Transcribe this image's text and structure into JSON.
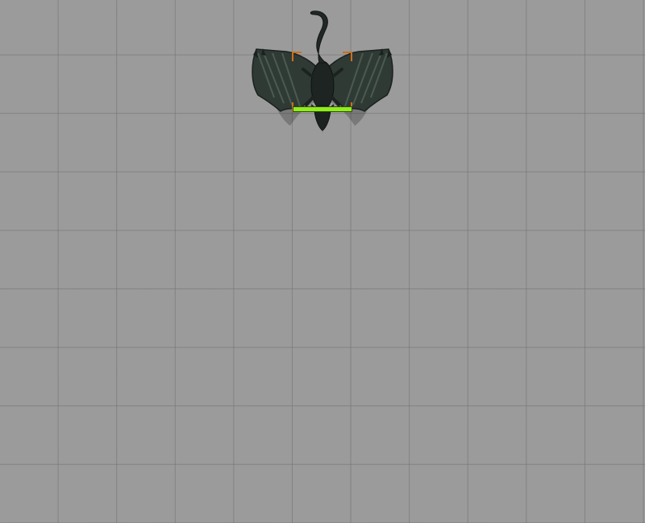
{
  "scene": {
    "grid_color": "#6e6e6e",
    "background_color": "#9b9b9b"
  },
  "token": {
    "icon": "dragon-icon",
    "selected": true,
    "selection_color": "#c8701e",
    "health_fraction": 1.0,
    "health_color": "#8ef01a"
  }
}
